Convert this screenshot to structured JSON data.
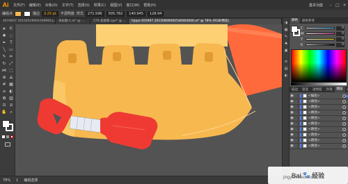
{
  "app": {
    "logo": "Ai",
    "workspace": "基本功能"
  },
  "menus": [
    "文件(F)",
    "编辑(E)",
    "对象(O)",
    "文字(T)",
    "选择(S)",
    "效果(C)",
    "视图(V)",
    "窗口(W)",
    "帮助(H)"
  ],
  "control_bar": {
    "selection_label": "编组点",
    "stroke_label": "描边",
    "stroke_value": "3.25 pt",
    "opacity_label": "不透明度",
    "style_label": "样式",
    "x_value": "271.596",
    "y_value": "505.782",
    "w_value": "140.945",
    "h_value": "128.94"
  },
  "doc_tabs": [
    {
      "label": "2674637 20150529091549001a.ai* @ ..."
    },
    {
      "label": "未标题-1.ai* @ ..."
    },
    {
      "label": "579 美丽家.eps* @ ..."
    },
    {
      "label": "hippo 455997 20150806092546004000.ai* @ 78% (RGB/预览)",
      "active": true
    }
  ],
  "status_bar": {
    "zoom": "78%",
    "page": "1",
    "tool": "编组选择"
  },
  "panels": {
    "color_tabs": [
      "颜色",
      "颜色参考"
    ],
    "color_sliders": [
      {
        "letter": "C",
        "value": "0",
        "color": "#35c8ff"
      },
      {
        "letter": "M",
        "value": "0",
        "color": "#ff3fa8"
      },
      {
        "letter": "Y",
        "value": "0",
        "color": "#ffe600"
      },
      {
        "letter": "K",
        "value": "0",
        "color": "#8a8a8a"
      }
    ],
    "layer_tabs": [
      "描边",
      "渐变",
      "透明度",
      "外观",
      "图层",
      "画板"
    ],
    "layers": [
      {
        "name": "<编组>",
        "selected": true
      },
      {
        "name": "<路径>"
      },
      {
        "name": "<路径>"
      },
      {
        "name": "<路径>"
      },
      {
        "name": "<路径>"
      },
      {
        "name": "<路径>"
      },
      {
        "name": "<路径>"
      },
      {
        "name": "<路径>"
      },
      {
        "name": "<路径>"
      },
      {
        "name": "<路径>"
      }
    ]
  },
  "watermark": {
    "brand": "Bai",
    "text": "经验",
    "url": "jingyan.baidu.com"
  },
  "colors": {
    "cake_body": "#f7b84f",
    "cake_top": "#fcd073",
    "accent_orange": "#ff6a3d",
    "shovel_red": "#ee3a33"
  }
}
